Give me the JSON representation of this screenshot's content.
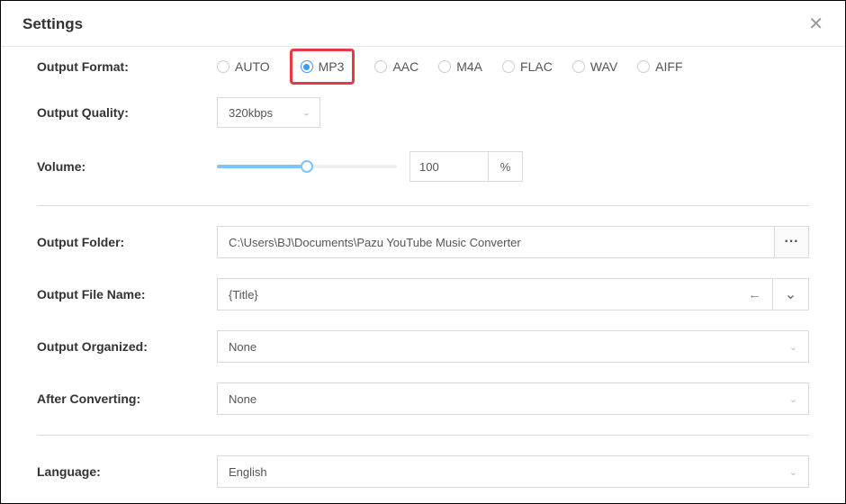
{
  "header": {
    "title": "Settings"
  },
  "labels": {
    "output_format": "Output Format:",
    "output_quality": "Output Quality:",
    "volume": "Volume:",
    "output_folder": "Output Folder:",
    "output_file_name": "Output File Name:",
    "output_organized": "Output Organized:",
    "after_converting": "After Converting:",
    "language": "Language:"
  },
  "output_format": {
    "options": [
      "AUTO",
      "MP3",
      "AAC",
      "M4A",
      "FLAC",
      "WAV",
      "AIFF"
    ],
    "selected": "MP3"
  },
  "output_quality": {
    "value": "320kbps"
  },
  "volume": {
    "value": "100",
    "unit": "%",
    "percent": 50
  },
  "output_folder": {
    "path": "C:\\Users\\BJ\\Documents\\Pazu YouTube Music Converter"
  },
  "output_file_name": {
    "template": "{Title}"
  },
  "output_organized": {
    "value": "None"
  },
  "after_converting": {
    "value": "None"
  },
  "language": {
    "value": "English"
  },
  "icons": {
    "more": "···",
    "back": "←",
    "chev_down": "⌄"
  }
}
